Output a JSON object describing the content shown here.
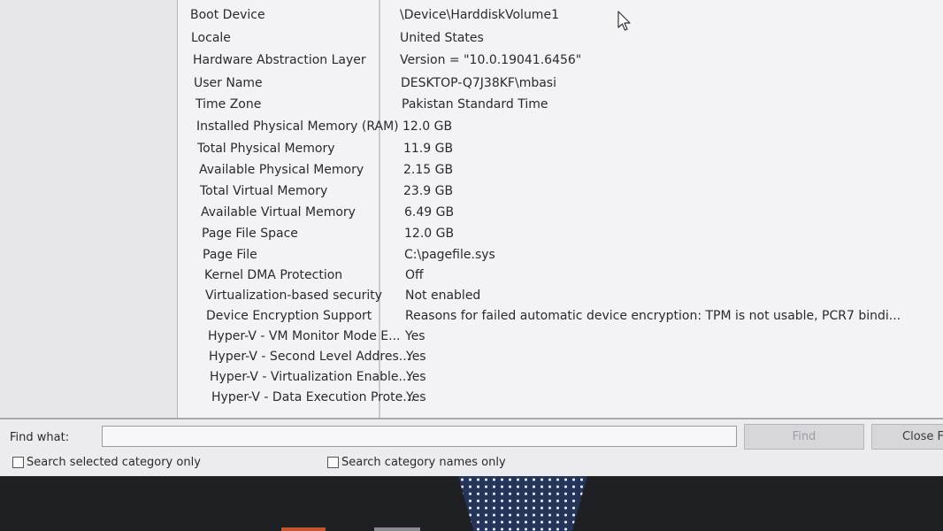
{
  "details": [
    {
      "item": "Boot Device",
      "value": "\\Device\\HarddiskVolume1"
    },
    {
      "item": "Locale",
      "value": "United States"
    },
    {
      "item": "Hardware Abstraction Layer",
      "value": "Version = \"10.0.19041.6456\""
    },
    {
      "item": "User Name",
      "value": "DESKTOP-Q7J38KF\\mbasi"
    },
    {
      "item": "Time Zone",
      "value": "Pakistan Standard Time"
    },
    {
      "item": "Installed Physical Memory (RAM)",
      "value": "12.0 GB"
    },
    {
      "item": "Total Physical Memory",
      "value": "11.9 GB"
    },
    {
      "item": "Available Physical Memory",
      "value": "2.15 GB"
    },
    {
      "item": "Total Virtual Memory",
      "value": "23.9 GB"
    },
    {
      "item": "Available Virtual Memory",
      "value": "6.49 GB"
    },
    {
      "item": "Page File Space",
      "value": "12.0 GB"
    },
    {
      "item": "Page File",
      "value": "C:\\pagefile.sys"
    },
    {
      "item": "Kernel DMA Protection",
      "value": "Off"
    },
    {
      "item": "Virtualization-based security",
      "value": "Not enabled"
    },
    {
      "item": "Device Encryption Support",
      "value": "Reasons for failed automatic device encryption: TPM is not usable, PCR7 bindi..."
    },
    {
      "item": "Hyper-V - VM Monitor Mode E...",
      "value": "Yes"
    },
    {
      "item": "Hyper-V - Second Level Addres...",
      "value": "Yes"
    },
    {
      "item": "Hyper-V - Virtualization Enable...",
      "value": "Yes"
    },
    {
      "item": "Hyper-V - Data Execution Prote...",
      "value": "Yes"
    }
  ],
  "find_bar": {
    "label": "Find what:",
    "input_value": "",
    "find_button": "Find",
    "close_button": "Close F",
    "check_selected_category": "Search selected category only",
    "check_category_names": "Search category names only"
  },
  "colors": {
    "window_bg": "#ececef",
    "taskbar_bg": "#1e2024",
    "taskbar_marker": "#c0562a"
  },
  "icons": [
    "mouse-pointer-icon",
    "checkbox-icon"
  ]
}
